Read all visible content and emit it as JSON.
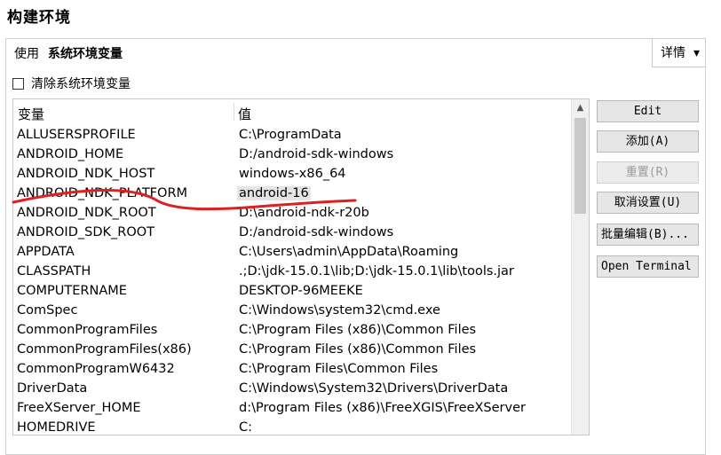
{
  "window": {
    "title": "构建环境"
  },
  "use_row": {
    "prefix": "使用",
    "value": "系统环境变量"
  },
  "details": {
    "label": "详情",
    "chevron": "▾"
  },
  "clear_env": {
    "label": "清除系统环境变量",
    "checked": false
  },
  "table": {
    "headers": {
      "name": "变量",
      "value": "值"
    },
    "selected_value_row": 3,
    "rows": [
      {
        "name": "ALLUSERSPROFILE",
        "value": "C:\\ProgramData"
      },
      {
        "name": "ANDROID_HOME",
        "value": "D:/android-sdk-windows"
      },
      {
        "name": "ANDROID_NDK_HOST",
        "value": "windows-x86_64"
      },
      {
        "name": "ANDROID_NDK_PLATFORM",
        "value": "android-16"
      },
      {
        "name": "ANDROID_NDK_ROOT",
        "value": "D:\\android-ndk-r20b"
      },
      {
        "name": "ANDROID_SDK_ROOT",
        "value": "D:/android-sdk-windows"
      },
      {
        "name": "APPDATA",
        "value": "C:\\Users\\admin\\AppData\\Roaming"
      },
      {
        "name": "CLASSPATH",
        "value": ".;D:\\jdk-15.0.1\\lib;D:\\jdk-15.0.1\\lib\\tools.jar"
      },
      {
        "name": "COMPUTERNAME",
        "value": "DESKTOP-96MEEKE"
      },
      {
        "name": "ComSpec",
        "value": "C:\\Windows\\system32\\cmd.exe"
      },
      {
        "name": "CommonProgramFiles",
        "value": "C:\\Program Files (x86)\\Common Files"
      },
      {
        "name": "CommonProgramFiles(x86)",
        "value": "C:\\Program Files (x86)\\Common Files"
      },
      {
        "name": "CommonProgramW6432",
        "value": "C:\\Program Files\\Common Files"
      },
      {
        "name": "DriverData",
        "value": "C:\\Windows\\System32\\Drivers\\DriverData"
      },
      {
        "name": "FreeXServer_HOME",
        "value": "d:\\Program Files (x86)\\FreeXGIS\\FreeXServer"
      },
      {
        "name": "HOMEDRIVE",
        "value": "C:"
      }
    ]
  },
  "buttons": {
    "edit": "Edit",
    "add": "添加(A)",
    "reset": "重置(R)",
    "unset": "取消设置(U)",
    "batch_edit": "批量编辑(B)...",
    "open_terminal": "Open Terminal"
  },
  "annotation": {
    "color": "#e02020"
  }
}
